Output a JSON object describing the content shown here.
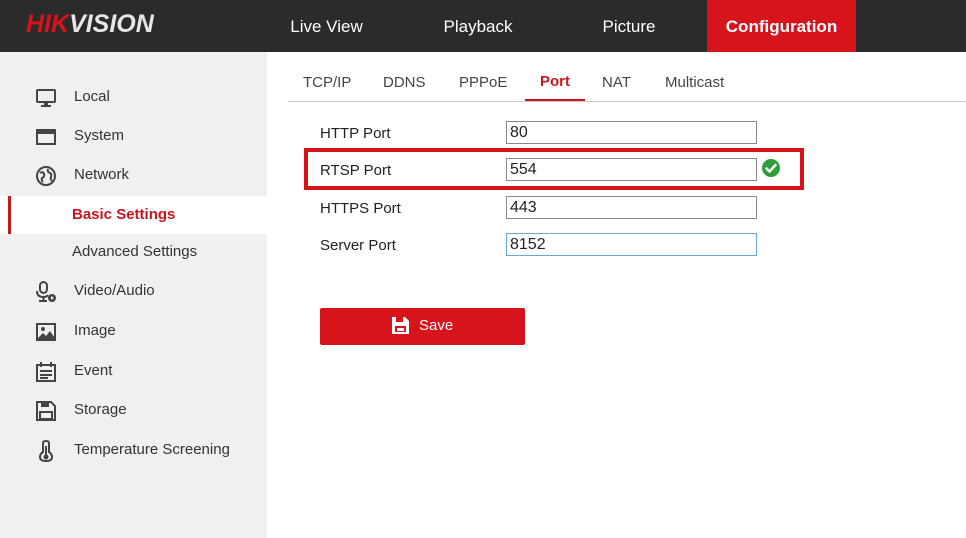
{
  "brand": {
    "part1": "HIK",
    "part2": "VISION"
  },
  "nav": [
    {
      "label": "Live View"
    },
    {
      "label": "Playback"
    },
    {
      "label": "Picture"
    },
    {
      "label": "Configuration"
    }
  ],
  "sidebar": {
    "items": [
      {
        "label": "Local",
        "icon": "monitor-icon"
      },
      {
        "label": "System",
        "icon": "window-icon"
      },
      {
        "label": "Network",
        "icon": "globe-icon"
      },
      {
        "label": "Basic Settings"
      },
      {
        "label": "Advanced Settings"
      },
      {
        "label": "Video/Audio",
        "icon": "microphone-icon"
      },
      {
        "label": "Image",
        "icon": "image-icon"
      },
      {
        "label": "Event",
        "icon": "calendar-icon"
      },
      {
        "label": "Storage",
        "icon": "save-icon"
      },
      {
        "label": "Temperature Screening",
        "icon": "thermometer-icon"
      }
    ]
  },
  "tabs": [
    {
      "label": "TCP/IP"
    },
    {
      "label": "DDNS"
    },
    {
      "label": "PPPoE"
    },
    {
      "label": "Port"
    },
    {
      "label": "NAT"
    },
    {
      "label": "Multicast"
    }
  ],
  "form": {
    "fields": [
      {
        "label": "HTTP Port",
        "value": "80"
      },
      {
        "label": "RTSP Port",
        "value": "554"
      },
      {
        "label": "HTTPS Port",
        "value": "443"
      },
      {
        "label": "Server Port",
        "value": "8152"
      }
    ],
    "save_label": "Save"
  },
  "colors": {
    "accent": "#d7131b",
    "topbar": "#2b2b2b",
    "sidebar_bg": "#f0f0f0",
    "valid_check": "#2e9e3a"
  }
}
